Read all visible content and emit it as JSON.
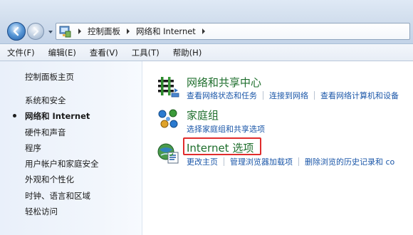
{
  "address": {
    "breadcrumbs": [
      "控制面板",
      "网络和 Internet"
    ]
  },
  "menu": [
    "文件(F)",
    "编辑(E)",
    "查看(V)",
    "工具(T)",
    "帮助(H)"
  ],
  "sidebar": {
    "home": "控制面板主页",
    "items": [
      {
        "label": "系统和安全",
        "active": false
      },
      {
        "label": "网络和 Internet",
        "active": true
      },
      {
        "label": "硬件和声音",
        "active": false
      },
      {
        "label": "程序",
        "active": false
      },
      {
        "label": "用户帐户和家庭安全",
        "active": false
      },
      {
        "label": "外观和个性化",
        "active": false
      },
      {
        "label": "时钟、语言和区域",
        "active": false
      },
      {
        "label": "轻松访问",
        "active": false
      }
    ]
  },
  "categories": [
    {
      "title": "网络和共享中心",
      "icon": "network-sharing-icon",
      "links": [
        "查看网络状态和任务",
        "连接到网络",
        "查看网络计算机和设备"
      ]
    },
    {
      "title": "家庭组",
      "icon": "homegroup-icon",
      "links": [
        "选择家庭组和共享选项"
      ]
    },
    {
      "title": "Internet 选项",
      "icon": "internet-options-icon",
      "links": [
        "更改主页",
        "管理浏览器加载项",
        "删除浏览的历史记录和 co"
      ]
    }
  ],
  "colors": {
    "category_title": "#1e6e2c",
    "link": "#1a56a8",
    "highlight": "#e02c2c"
  }
}
